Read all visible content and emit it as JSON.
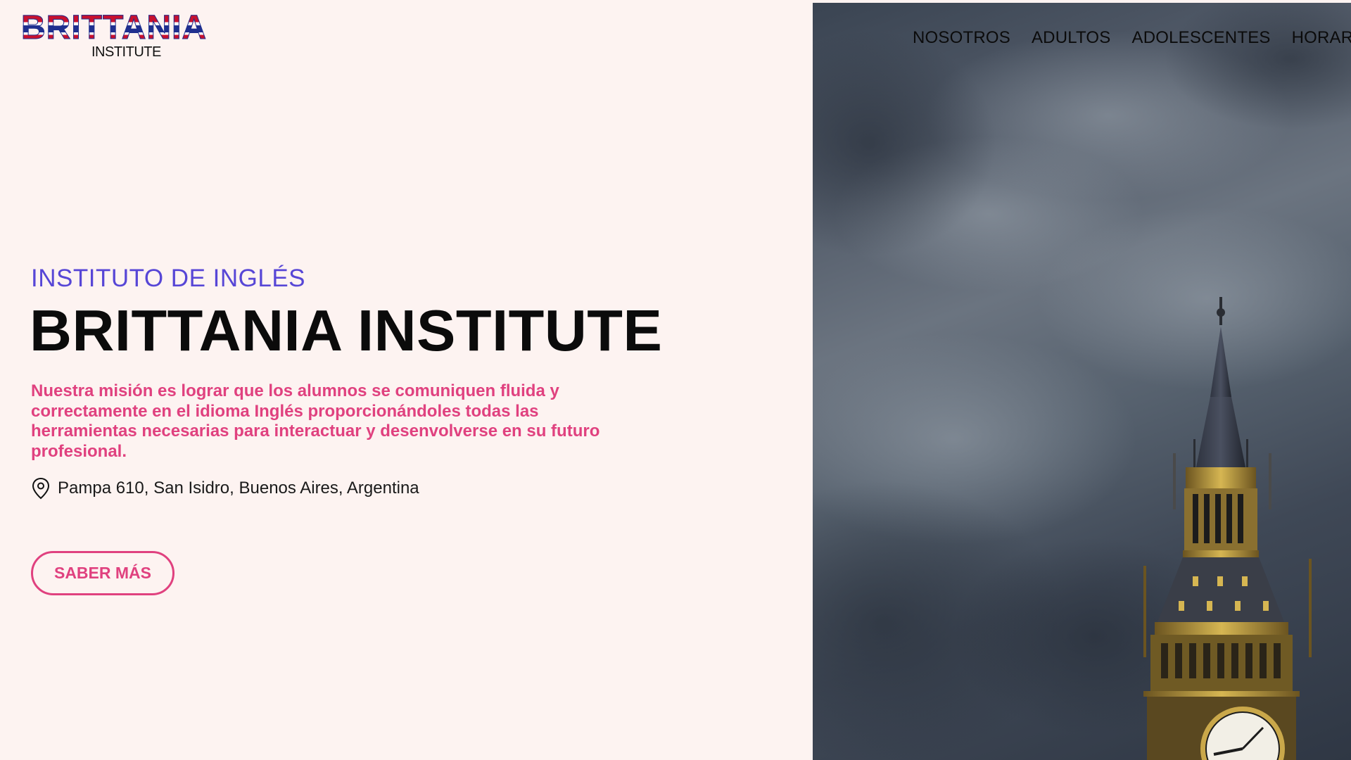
{
  "brand": {
    "logo_text": "BRITTANIA",
    "logo_sub": "INSTITUTE"
  },
  "nav": {
    "items": [
      {
        "label": "NOSOTROS"
      },
      {
        "label": "ADULTOS"
      },
      {
        "label": "ADOLESCENTES"
      },
      {
        "label": "HORARIOS"
      }
    ]
  },
  "hero": {
    "eyebrow": "INSTITUTO DE INGLÉS",
    "title": "BRITTANIA INSTITUTE",
    "mission": "Nuestra misión es lograr que los alumnos se comuniquen fluida y correctamente en el idioma Inglés proporcionándoles todas las herramientas necesarias para interactuar y desenvolverse en su futuro profesional.",
    "address": "Pampa 610, San Isidro, Buenos Aires, Argentina",
    "cta_label": "SABER MÁS"
  },
  "colors": {
    "background": "#fdf3f1",
    "accent_purple": "#5746d6",
    "accent_pink": "#e0417f",
    "title": "#0b0b0b"
  },
  "icons": {
    "address": "map-pin-icon"
  }
}
